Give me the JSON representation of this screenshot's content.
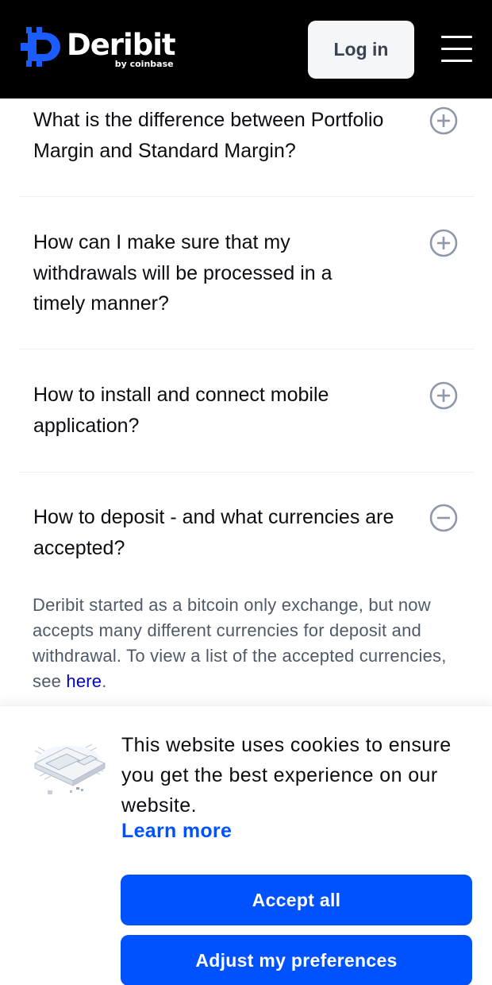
{
  "header": {
    "logo_word": "Deribit",
    "logo_sub": "by coinbase",
    "login_label": "Log in",
    "menu_icon": "hamburger-menu-icon"
  },
  "faq": {
    "items": [
      {
        "question": "What is the difference between Portfolio Margin and Standard Margin?",
        "state": "collapsed",
        "icon": "plus-circle-icon"
      },
      {
        "question": "How can I make sure that my withdrawals will be processed in a timely manner?",
        "state": "collapsed",
        "icon": "plus-circle-icon"
      },
      {
        "question": "How to install and connect mobile application?",
        "state": "collapsed",
        "icon": "plus-circle-icon"
      },
      {
        "question": "How to deposit - and what currencies are accepted?",
        "state": "expanded",
        "icon": "minus-circle-icon"
      }
    ],
    "answer": {
      "text": "Deribit started as a bitcoin only exchange, but now accepts many different currencies for deposit and withdrawal. To view a list of the accepted currencies, see ",
      "link": "here",
      "suffix": "."
    }
  },
  "cookie_banner": {
    "message": "This website uses cookies to ensure you get the best experience on our website.",
    "learn_more": "Learn more",
    "accept_all": "Accept all",
    "adjust_preferences": "Adjust my preferences",
    "illustration": "cookie-chip-illustration"
  },
  "colors": {
    "header_bg": "#000000",
    "brand_blue": "#0052ff",
    "logo_blue": "#1a5cff",
    "answer_text": "#4f5969",
    "link": "#0000c8",
    "toggle_icon": "#8f97a8"
  }
}
